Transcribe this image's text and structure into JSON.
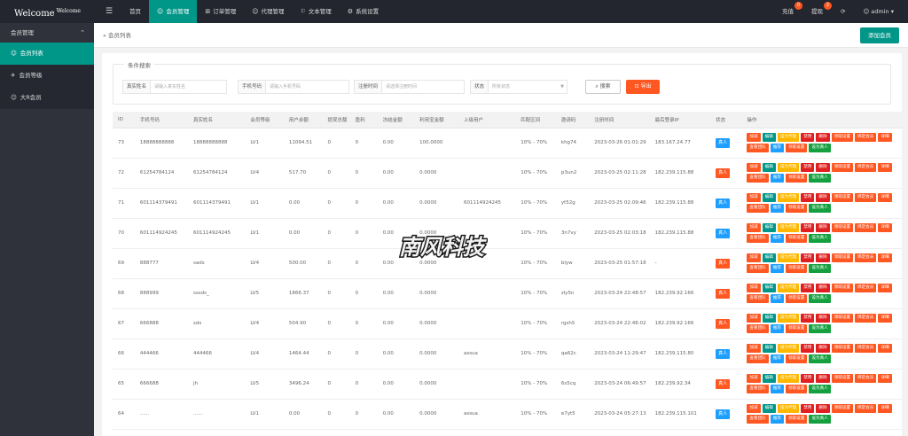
{
  "app": {
    "title": "Welcome",
    "title_sup": "Welcome"
  },
  "nav": [
    {
      "label": "首页",
      "icon": "home-icon",
      "glyph": ""
    },
    {
      "label": "会员管理",
      "icon": "user-icon",
      "glyph": "☺"
    },
    {
      "label": "订单管理",
      "icon": "order-icon",
      "glyph": "⊞"
    },
    {
      "label": "代理管理",
      "icon": "agent-icon",
      "glyph": "☺"
    },
    {
      "label": "文本管理",
      "icon": "flag-icon",
      "glyph": "⚐"
    },
    {
      "label": "系统设置",
      "icon": "gear-icon",
      "glyph": "⚙"
    }
  ],
  "top_right": {
    "recharge": "充值",
    "recharge_badge": "0",
    "withdraw": "提现",
    "withdraw_badge": "2",
    "user": "admin"
  },
  "sidebar": {
    "group": "会员管理",
    "items": [
      {
        "label": "会员列表",
        "icon": "user-icon",
        "glyph": "☺"
      },
      {
        "label": "会员等级",
        "icon": "level-icon",
        "glyph": "✈"
      },
      {
        "label": "大R会员",
        "icon": "vip-icon",
        "glyph": "☺"
      }
    ]
  },
  "breadcrumb": {
    "text": "会员列表"
  },
  "add_button": "添加会员",
  "search": {
    "legend": "条件搜索",
    "fields": [
      {
        "label": "真实姓名",
        "placeholder": "请输入真实姓名"
      },
      {
        "label": "手机号码",
        "placeholder": "请输入手机号码"
      },
      {
        "label": "注册时间",
        "placeholder": "请选择注册时间"
      },
      {
        "label": "状态",
        "placeholder": "所有状态"
      }
    ],
    "search_button": "搜索",
    "export_button": "导出"
  },
  "table": {
    "columns": [
      "ID",
      "手机号码",
      "真实姓名",
      "会员等级",
      "用户余额",
      "提现总额",
      "盈利",
      "冻结金额",
      "利用宝金额",
      "上级用户",
      "匹配区间",
      "邀请码",
      "注册时间",
      "最后登录IP",
      "状态",
      "操作"
    ],
    "ops": [
      {
        "label": "加减",
        "color": "#ff5722"
      },
      {
        "label": "编辑",
        "color": "#009688"
      },
      {
        "label": "设为代理",
        "color": "#ffb800"
      },
      {
        "label": "禁用",
        "color": "#e02020"
      },
      {
        "label": "删除",
        "color": "#e02020"
      },
      {
        "label": "领取设置",
        "color": "#ff5722"
      },
      {
        "label": "绑定会员",
        "color": "#ff5722"
      },
      {
        "label": "详细",
        "color": "#ff5722"
      },
      {
        "label": "查看团队",
        "color": "#ff5722"
      },
      {
        "label": "推荐",
        "color": "#1e9fff"
      },
      {
        "label": "领取设置",
        "color": "#ff5722"
      },
      {
        "label": "设为真人",
        "color": "#14a03e"
      }
    ],
    "rows": [
      {
        "id": "73",
        "phone": "18888888888",
        "name": "18888888888",
        "level": "LV1",
        "balance": "11094.51",
        "withdraw": "0",
        "profit": "0",
        "frozen": "0.00",
        "lyb": "100.0000",
        "parent": "",
        "range": "10% - 70%",
        "code": "khg74",
        "reg": "2023-03-26 01:01:29",
        "ip": "183.167.24.77",
        "status": "真人",
        "status_color": "#1e9fff"
      },
      {
        "id": "72",
        "phone": "61254784124",
        "name": "61254784124",
        "level": "LV4",
        "balance": "517.70",
        "withdraw": "0",
        "profit": "0",
        "frozen": "0.00",
        "lyb": "0.0000",
        "parent": "",
        "range": "10% - 70%",
        "code": "p3un2",
        "reg": "2023-03-25 02:11:28",
        "ip": "182.239.115.88",
        "status": "真人",
        "status_color": "#ff5722"
      },
      {
        "id": "71",
        "phone": "601114379491",
        "name": "601114379491",
        "level": "LV1",
        "balance": "0.00",
        "withdraw": "0",
        "profit": "0",
        "frozen": "0.00",
        "lyb": "0.0000",
        "parent": "601114924245",
        "range": "10% - 70%",
        "code": "yt52g",
        "reg": "2023-03-25 02:09:46",
        "ip": "182.239.115.88",
        "status": "真人",
        "status_color": "#1e9fff"
      },
      {
        "id": "70",
        "phone": "601114924245",
        "name": "601114924245",
        "level": "LV1",
        "balance": "0.00",
        "withdraw": "0",
        "profit": "0",
        "frozen": "0.00",
        "lyb": "0.0000",
        "parent": "",
        "range": "10% - 70%",
        "code": "3n7vy",
        "reg": "2023-03-25 02:03:18",
        "ip": "182.239.115.88",
        "status": "真人",
        "status_color": "#1e9fff"
      },
      {
        "id": "69",
        "phone": "888777",
        "name": "sads",
        "level": "LV4",
        "balance": "500.00",
        "withdraw": "0",
        "profit": "0",
        "frozen": "0.00",
        "lyb": "0.0000",
        "parent": "",
        "range": "10% - 70%",
        "code": "blyw",
        "reg": "2023-03-25 01:57:18",
        "ip": "-",
        "status": "真人",
        "status_color": "#ff5722"
      },
      {
        "id": "68",
        "phone": "888999",
        "name": "sssds_",
        "level": "LV5",
        "balance": "1866.37",
        "withdraw": "0",
        "profit": "0",
        "frozen": "0.00",
        "lyb": "0.0000",
        "parent": "",
        "range": "10% - 70%",
        "code": "zly5n",
        "reg": "2023-03-24 22:48:57",
        "ip": "182.239.92.166",
        "status": "真人",
        "status_color": "#ff5722"
      },
      {
        "id": "67",
        "phone": "666888",
        "name": "sds",
        "level": "LV4",
        "balance": "504.90",
        "withdraw": "0",
        "profit": "0",
        "frozen": "0.00",
        "lyb": "0.0000",
        "parent": "",
        "range": "10% - 70%",
        "code": "rgsh5",
        "reg": "2023-03-24 22:46:02",
        "ip": "182.239.92.166",
        "status": "真人",
        "status_color": "#ff5722"
      },
      {
        "id": "66",
        "phone": "444466",
        "name": "444466",
        "level": "LV4",
        "balance": "1464.44",
        "withdraw": "0",
        "profit": "0",
        "frozen": "0.00",
        "lyb": "0.0000",
        "parent": "assua",
        "range": "10% - 70%",
        "code": "qa62c",
        "reg": "2023-03-24 11:29:47",
        "ip": "182.239.115.80",
        "status": "真人",
        "status_color": "#1e9fff"
      },
      {
        "id": "65",
        "phone": "666688",
        "name": "jh",
        "level": "LV5",
        "balance": "3496.24",
        "withdraw": "0",
        "profit": "0",
        "frozen": "0.00",
        "lyb": "0.0000",
        "parent": "",
        "range": "10% - 70%",
        "code": "6s5cq",
        "reg": "2023-03-24 06:49:57",
        "ip": "182.239.92.34",
        "status": "真人",
        "status_color": "#ff5722"
      },
      {
        "id": "64",
        "phone": "......",
        "name": "......",
        "level": "LV1",
        "balance": "0.00",
        "withdraw": "0",
        "profit": "0",
        "frozen": "0.00",
        "lyb": "0.0000",
        "parent": "assua",
        "range": "10% - 70%",
        "code": "e7yt5",
        "reg": "2023-03-24 05:27:13",
        "ip": "182.239.115.101",
        "status": "真人",
        "status_color": "#1e9fff"
      }
    ]
  },
  "watermark": {
    "text": "南风科技"
  },
  "colors": {
    "topbar": "#23262e",
    "sidebar": "#2f323a",
    "accent": "#009688",
    "danger": "#ff5722"
  }
}
